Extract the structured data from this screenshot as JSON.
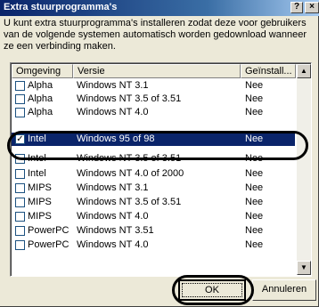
{
  "dialog": {
    "title": "Extra stuurprogramma's",
    "help_glyph": "?",
    "close_glyph": "×",
    "intro_text": "U kunt extra stuurprogramma's installeren zodat deze voor gebruikers van de volgende systemen automatisch worden gedownload wanneer ze een verbinding maken."
  },
  "list": {
    "columns": [
      "Omgeving",
      "Versie",
      "Geïnstall..."
    ],
    "scroll_up_glyph": "▲",
    "scroll_down_glyph": "▼",
    "rows": [
      {
        "env": "Alpha",
        "version": "Windows NT 3.1",
        "installed": "Nee",
        "checked": false
      },
      {
        "env": "Alpha",
        "version": "Windows NT 3.5 of 3.51",
        "installed": "Nee",
        "checked": false
      },
      {
        "env": "Alpha",
        "version": "Windows NT 4.0",
        "installed": "Nee",
        "checked": false
      },
      {
        "env": "Intel",
        "version": "Windows 95 of 98",
        "installed": "Nee",
        "checked": true
      },
      {
        "env": "Intel",
        "version": "Windows NT 3.5 of 3.51",
        "installed": "Nee",
        "checked": false
      },
      {
        "env": "Intel",
        "version": "Windows NT 4.0 of 2000",
        "installed": "Nee",
        "checked": false
      },
      {
        "env": "MIPS",
        "version": "Windows NT 3.1",
        "installed": "Nee",
        "checked": false
      },
      {
        "env": "MIPS",
        "version": "Windows NT 3.5 of 3.51",
        "installed": "Nee",
        "checked": false
      },
      {
        "env": "MIPS",
        "version": "Windows NT 4.0",
        "installed": "Nee",
        "checked": false
      },
      {
        "env": "PowerPC",
        "version": "Windows NT 3.51",
        "installed": "Nee",
        "checked": false
      },
      {
        "env": "PowerPC",
        "version": "Windows NT 4.0",
        "installed": "Nee",
        "checked": false
      }
    ],
    "check_glyph": "✓"
  },
  "buttons": {
    "ok": "OK",
    "cancel": "Annuleren"
  }
}
